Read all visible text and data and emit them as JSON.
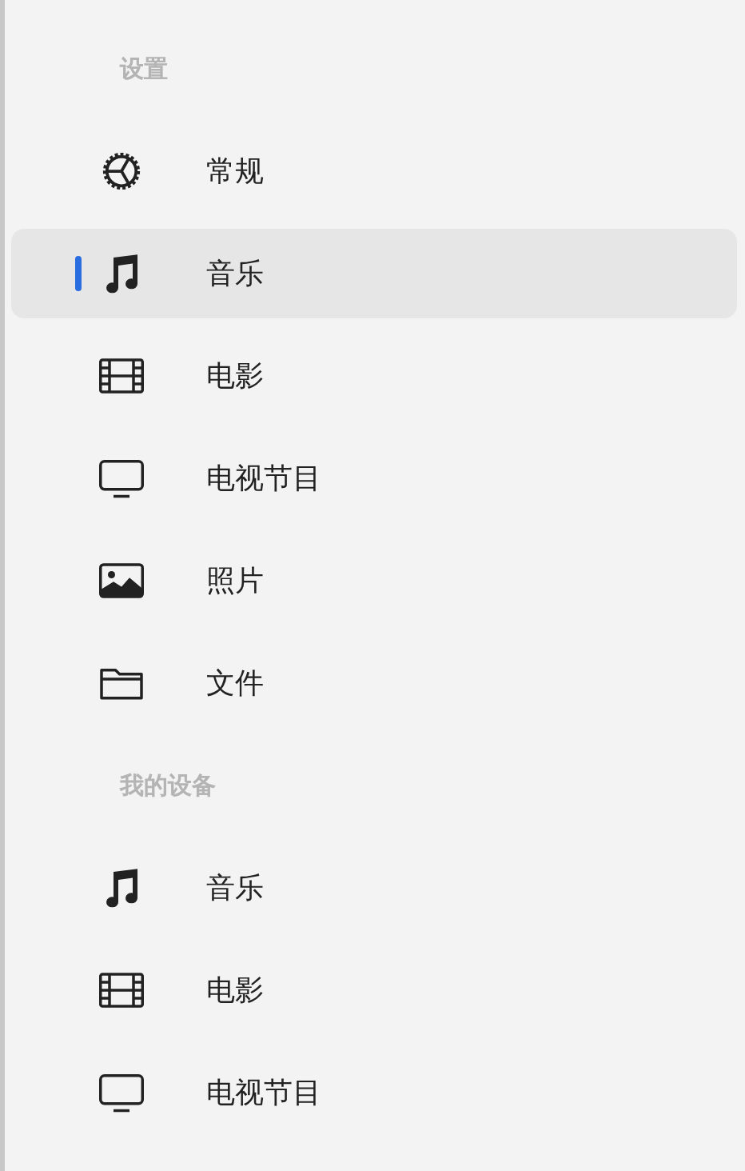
{
  "sections": [
    {
      "title": "设置",
      "items": [
        {
          "kind": "gear",
          "label": "常规",
          "selected": false
        },
        {
          "kind": "music",
          "label": "音乐",
          "selected": true
        },
        {
          "kind": "film",
          "label": "电影",
          "selected": false
        },
        {
          "kind": "tv",
          "label": "电视节目",
          "selected": false
        },
        {
          "kind": "photo",
          "label": "照片",
          "selected": false
        },
        {
          "kind": "folder",
          "label": "文件",
          "selected": false
        }
      ]
    },
    {
      "title": "我的设备",
      "items": [
        {
          "kind": "music",
          "label": "音乐",
          "selected": false
        },
        {
          "kind": "film",
          "label": "电影",
          "selected": false
        },
        {
          "kind": "tv",
          "label": "电视节目",
          "selected": false
        }
      ]
    }
  ]
}
